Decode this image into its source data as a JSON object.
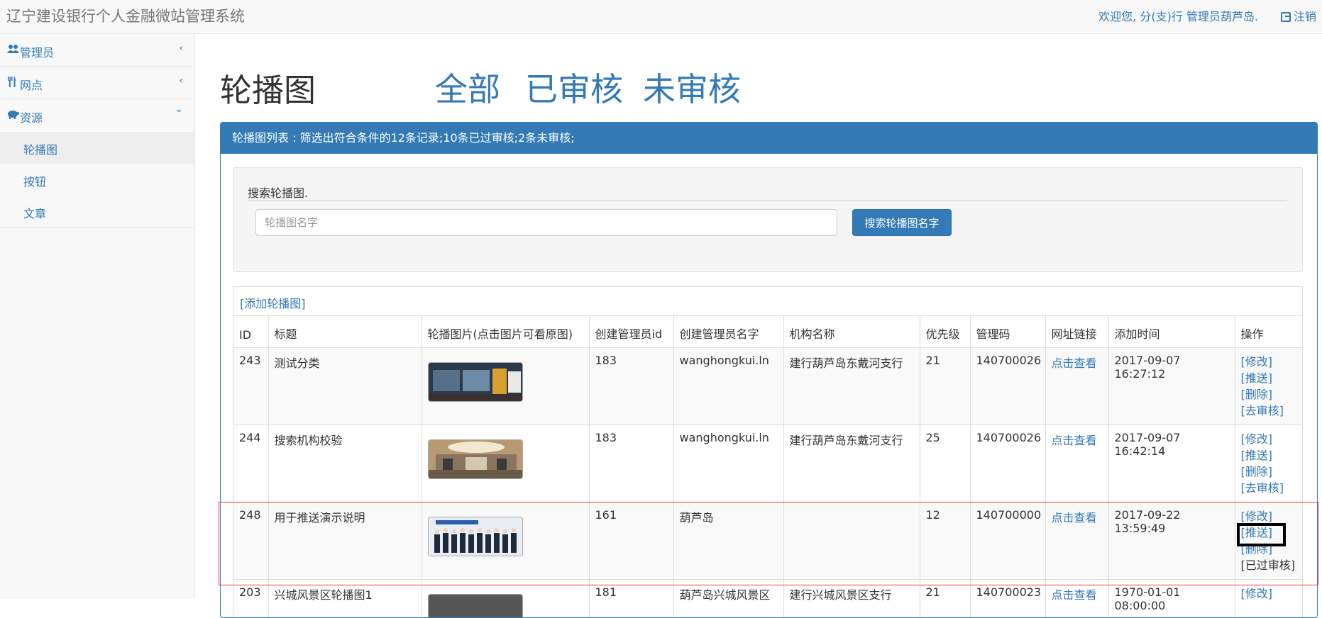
{
  "navbar": {
    "brand": "辽宁建设银行个人金融微站管理系统",
    "welcome": "欢迎您, 分(支)行 管理员葫芦岛.",
    "logout": "注销"
  },
  "sidebar": {
    "items": [
      {
        "label": "管理员",
        "icon": "users-icon",
        "chevron": "‹"
      },
      {
        "label": "网点",
        "icon": "cutlery-icon",
        "chevron": "‹"
      },
      {
        "label": "资源",
        "icon": "piggy-bank-icon",
        "chevron": "⌄"
      }
    ],
    "subitems": [
      {
        "label": "轮播图",
        "active": true
      },
      {
        "label": "按钮"
      },
      {
        "label": "文章"
      }
    ]
  },
  "main": {
    "title": "轮播图",
    "filters": [
      "全部",
      "已审核",
      "未审核"
    ],
    "panel_heading": "轮播图列表 : 筛选出符合条件的12条记录;10条已过审核;2条未审核;",
    "search": {
      "legend": "搜索轮播图.",
      "placeholder": "轮播图名字",
      "button": "搜索轮播图名字"
    },
    "add_link": "[添加轮播图]",
    "table": {
      "headers": [
        "ID",
        "标题",
        "轮播图片(点击图片可看原图)",
        "创建管理员id",
        "创建管理员名字",
        "机构名称",
        "优先级",
        "管理码",
        "网址链接",
        "添加时间",
        "操作"
      ],
      "rows": [
        {
          "id": "243",
          "title": "测试分类",
          "admin_id": "183",
          "admin_name": "wanghongkui.ln",
          "org": "建行葫芦岛东戴河支行",
          "priority": "21",
          "code": "140700026",
          "link": "点击查看",
          "time": "2017-09-07 16:27:12",
          "ops": [
            "[修改]",
            "[推送]",
            "[删除]",
            "[去审核]"
          ]
        },
        {
          "id": "244",
          "title": "搜索机构校验",
          "admin_id": "183",
          "admin_name": "wanghongkui.ln",
          "org": "建行葫芦岛东戴河支行",
          "priority": "25",
          "code": "140700026",
          "link": "点击查看",
          "time": "2017-09-07 16:42:14",
          "ops": [
            "[修改]",
            "[推送]",
            "[删除]",
            "[去审核]"
          ]
        },
        {
          "id": "248",
          "title": "用于推送演示说明",
          "admin_id": "161",
          "admin_name": "葫芦岛",
          "org": "",
          "priority": "12",
          "code": "140700000",
          "link": "点击查看",
          "time": "2017-09-22 13:59:49",
          "ops": [
            "[修改]",
            "[推送]",
            "[删除]",
            "[已过审核]"
          ]
        },
        {
          "id": "203",
          "title": "兴城风景区轮播图1",
          "admin_id": "181",
          "admin_name": "葫芦岛兴城风景区",
          "org": "建行兴城风景区支行",
          "priority": "21",
          "code": "140700023",
          "link": "点击查看",
          "time": "1970-01-01 08:00:00",
          "ops": [
            "[修改]"
          ]
        }
      ]
    }
  }
}
